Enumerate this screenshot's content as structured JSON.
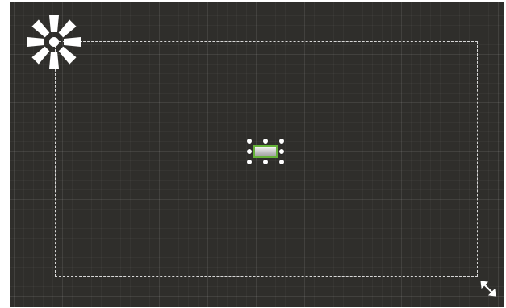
{
  "editor": {
    "settings_icon": "gear-icon",
    "resize_icon": "resize-diagonal-icon",
    "colors": {
      "canvas_background": "#2f2e2b",
      "grid_line": "#3b3a37",
      "bounds_border": "#d8d8d8",
      "selection_accent": "#66b23a",
      "handle": "#ffffff"
    }
  },
  "selected_element": {
    "kind": "button",
    "label": "",
    "selected": true,
    "handle_count": 8
  }
}
